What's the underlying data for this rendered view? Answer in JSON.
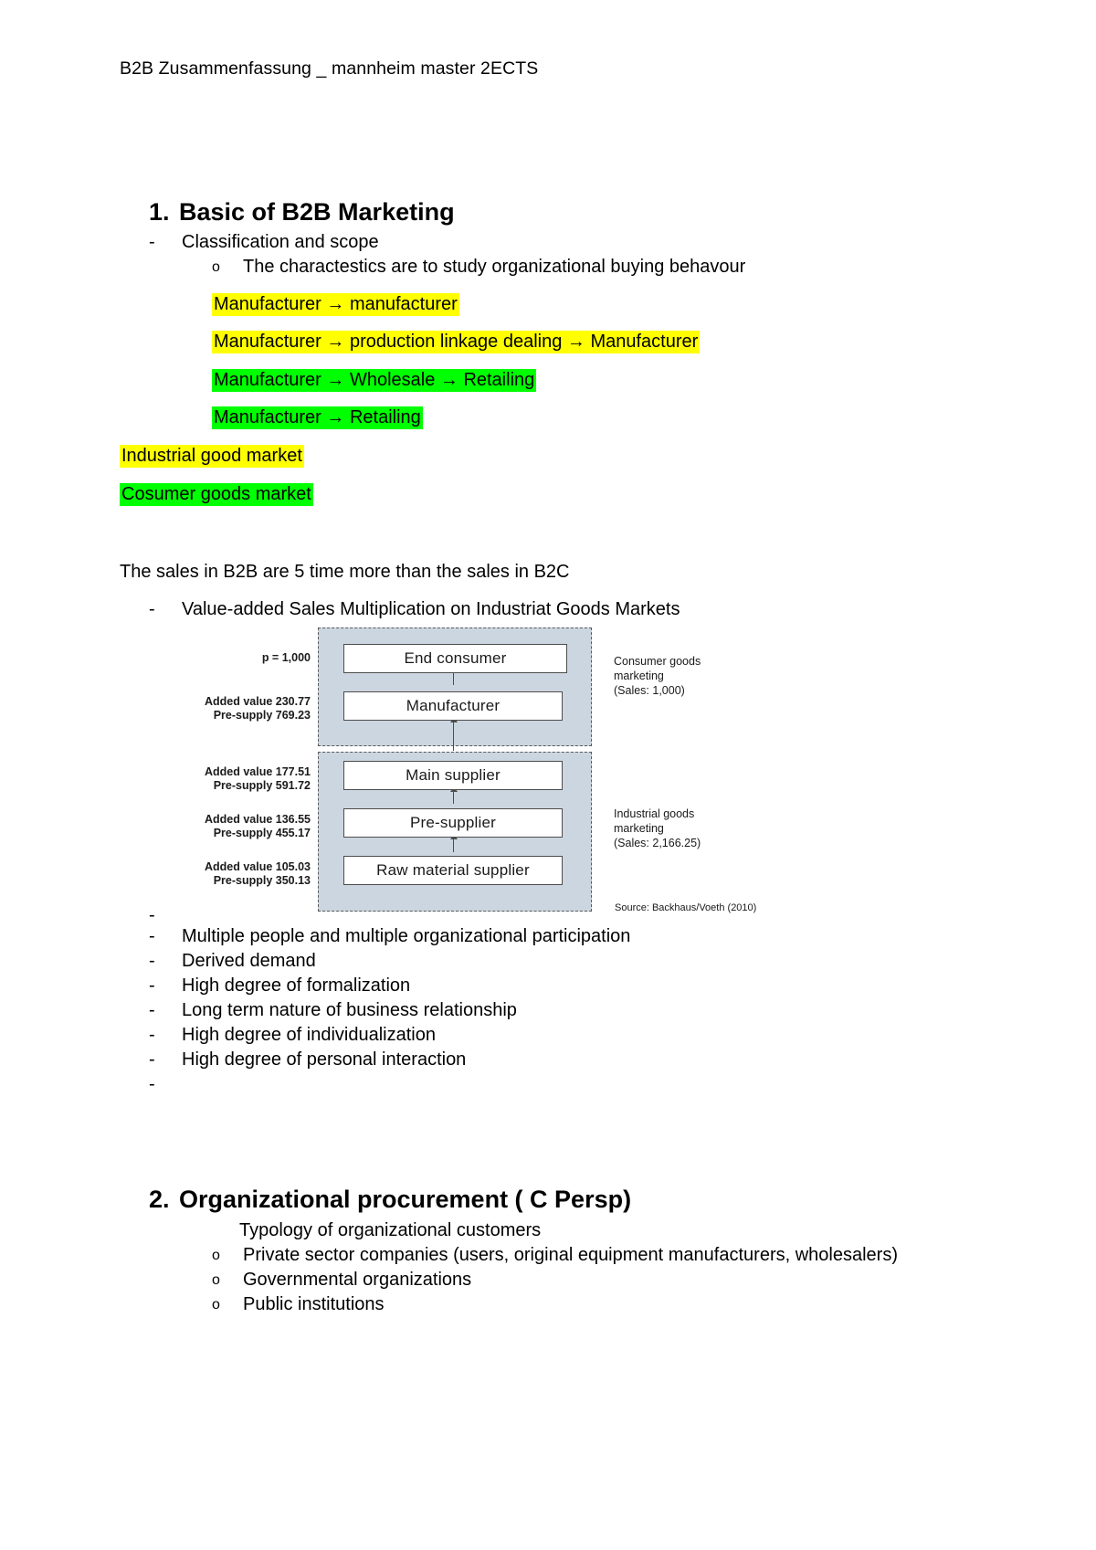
{
  "document": {
    "header": "B2B Zusammenfassung _ mannheim master 2ECTS"
  },
  "section1": {
    "number": "1.",
    "title": "Basic of  B2B Marketing",
    "bullet_dash": "-",
    "bullet_circle": "o",
    "items": [
      "Classification and  scope"
    ],
    "sub_items": [
      "The charactestics  are  to study  organizational buying behavour"
    ],
    "highlighted_chains": [
      {
        "before": "Manufacturer ",
        "arrow": "→",
        "after": " manufacturer",
        "color": "yellow",
        "text": "Manufacturer → manufacturer"
      },
      {
        "text": "Manufacturer → production linkage dealing → Manufacturer",
        "color": "yellow"
      },
      {
        "text": "Manufacturer → Wholesale → Retailing",
        "color": "green"
      },
      {
        "text": "Manufacturer → Retailing",
        "color": "green"
      }
    ],
    "market_labels": [
      {
        "text": "Industrial good market",
        "color": "yellow"
      },
      {
        "text": "Cosumer goods  market",
        "color": "green"
      }
    ],
    "sales_statement": "The sales in B2B are  5  time more  than the sales in B2C",
    "figure_caption": "Value-added Sales Multiplication on Industriat Goods Markets",
    "after_figure_bullets": [
      "",
      "Multiple people and multiple organizational participation",
      "Derived demand",
      "High degree of formalization",
      "Long term nature of business relationship",
      "High degree of individualization",
      "High degree of personal interaction",
      ""
    ]
  },
  "figure": {
    "price_label": "p = 1,000",
    "left_labels": [
      {
        "added_value": "Added value 230.77",
        "pre_supply": "Pre-supply 769.23"
      },
      {
        "added_value": "Added value 177.51",
        "pre_supply": "Pre-supply 591.72"
      },
      {
        "added_value": "Added value 136.55",
        "pre_supply": "Pre-supply 455.17"
      },
      {
        "added_value": "Added value 105.03",
        "pre_supply": "Pre-supply 350.13"
      }
    ],
    "boxes": [
      "End consumer",
      "Manufacturer",
      "Main supplier",
      "Pre-supplier",
      "Raw material supplier"
    ],
    "right_labels": [
      {
        "line1": "Consumer goods",
        "line2": "marketing",
        "line3": "(Sales: 1,000)"
      },
      {
        "line1": "Industrial goods",
        "line2": "marketing",
        "line3": "(Sales: 2,166.25)"
      }
    ],
    "source": "Source: Backhaus/Voeth (2010)",
    "colors": {
      "group_fill": "#ccd6e0",
      "box_border": "#4d4d4d"
    }
  },
  "section2": {
    "number": "2.",
    "title": "Organizational procurement  ( C Persp)",
    "subtitle": "Typology of organizational customers",
    "bullet_circle": "o",
    "items": [
      "Private sector companies (users, original equipment manufacturers, wholesalers)",
      "Governmental organizations",
      "Public institutions"
    ]
  }
}
